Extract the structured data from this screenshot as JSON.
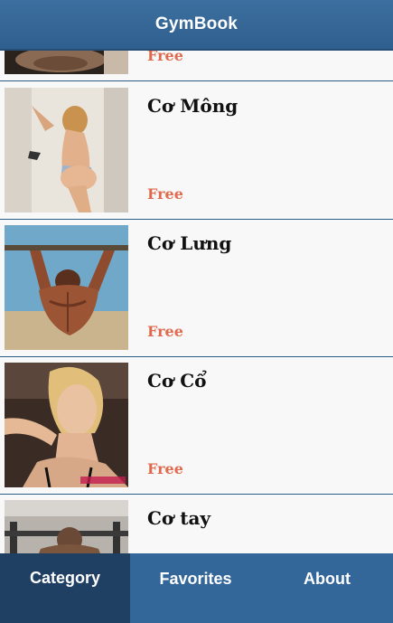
{
  "header": {
    "title": "GymBook"
  },
  "list": {
    "items": [
      {
        "name": "",
        "price": "Free",
        "image": "torso-photo"
      },
      {
        "name": "Cơ Mông",
        "price": "Free",
        "image": "glutes-photo"
      },
      {
        "name": "Cơ Lưng",
        "price": "Free",
        "image": "back-pullup-photo"
      },
      {
        "name": "Cơ Cổ",
        "price": "Free",
        "image": "neck-photo"
      },
      {
        "name": "Cơ tay",
        "price": "",
        "image": "arms-photo"
      }
    ]
  },
  "tabs": [
    {
      "label": "Category",
      "active": true
    },
    {
      "label": "Favorites",
      "active": false
    },
    {
      "label": "About",
      "active": false
    }
  ],
  "colors": {
    "header": "#336699",
    "active_tab": "#1f3f63",
    "price": "#e06a4d",
    "divider": "#2d5d86"
  }
}
